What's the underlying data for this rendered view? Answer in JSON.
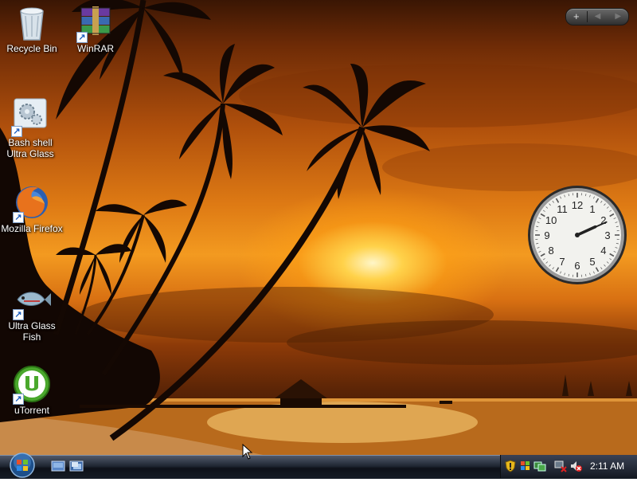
{
  "desktop": {
    "icons": [
      {
        "label_line1": "Recycle Bin",
        "label_line2": "",
        "icon": "recycle-bin-icon"
      },
      {
        "label_line1": "WinRAR",
        "label_line2": "",
        "icon": "winrar-icon"
      },
      {
        "label_line1": "Bash shell",
        "label_line2": "Ultra Glass",
        "icon": "gears-icon"
      },
      {
        "label_line1": "Mozilla Firefox",
        "label_line2": "",
        "icon": "firefox-icon"
      },
      {
        "label_line1": "Ultra Glass",
        "label_line2": "Fish",
        "icon": "fish-icon"
      },
      {
        "label_line1": "uTorrent",
        "label_line2": "",
        "icon": "utorrent-icon"
      }
    ]
  },
  "sidebar_control": {
    "add_label": "+",
    "prev_label": "◀",
    "next_label": "▶"
  },
  "clock_gadget": {
    "numbers": [
      "12",
      "1",
      "2",
      "3",
      "4",
      "5",
      "6",
      "7",
      "8",
      "9",
      "10",
      "11"
    ],
    "hour": 2,
    "minute": 11
  },
  "taskbar": {
    "time": "2:11 AM",
    "quick_launch": [
      "show-desktop-icon",
      "switch-windows-icon"
    ],
    "tray_icons": [
      "security-shield-icon",
      "windows-update-icon",
      "network-icon",
      "volume-muted-icon"
    ]
  },
  "colors": {
    "taskbar": "#1f2632",
    "sky_glow": "#f39a20",
    "sun": "#fff6c8"
  }
}
